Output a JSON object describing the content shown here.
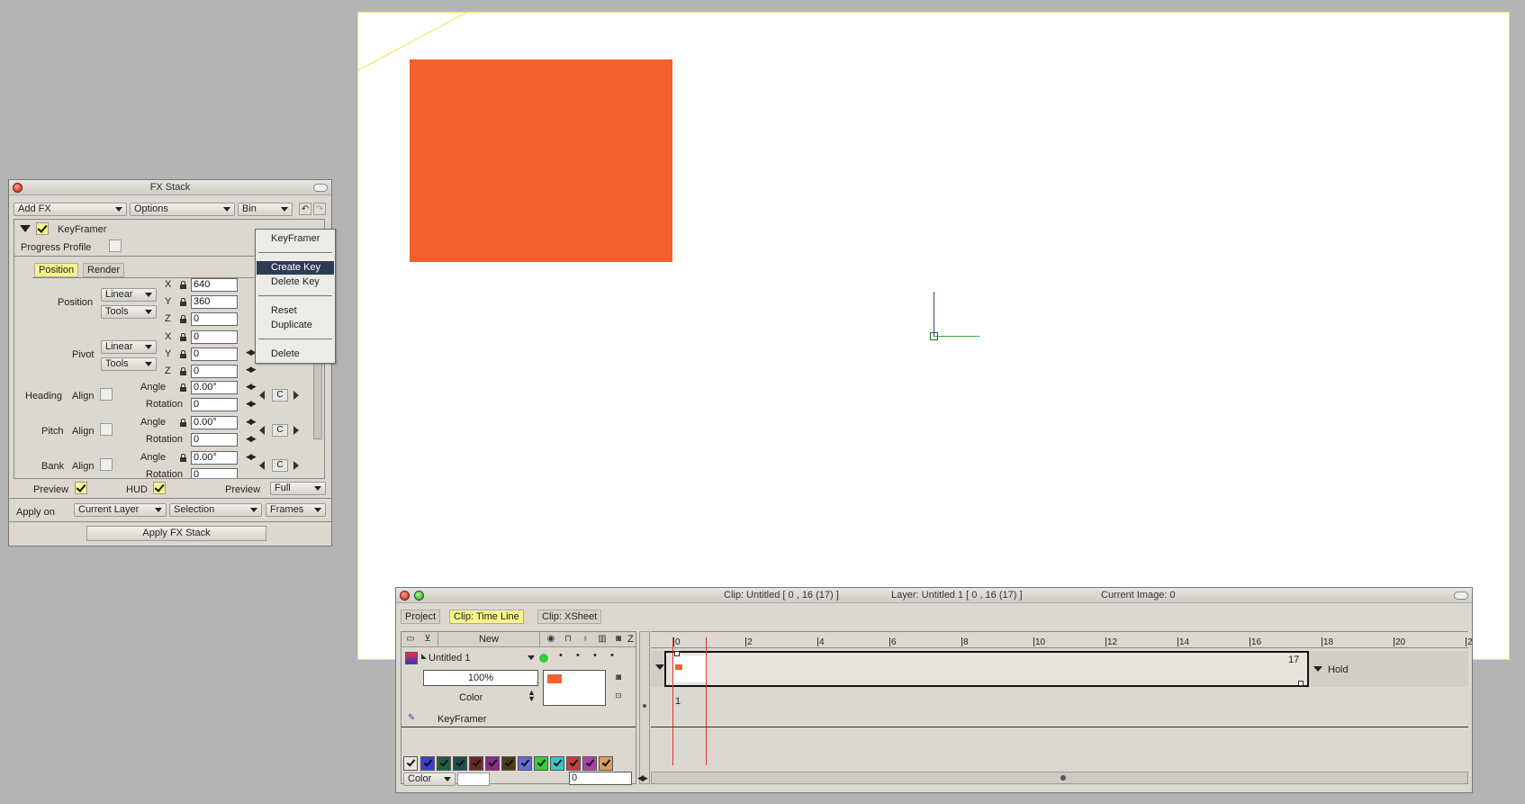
{
  "fx_stack": {
    "title": "FX Stack",
    "add_fx": "Add FX",
    "options": "Options",
    "bin": "Bin",
    "effect_name": "KeyFramer",
    "progress_profile": "Progress Profile",
    "tabs": [
      "Position",
      "Render"
    ],
    "position_label": "Position",
    "pivot_label": "Pivot",
    "linear": "Linear",
    "tools": "Tools",
    "axes": [
      "X",
      "Y",
      "Z"
    ],
    "position_values": [
      "640",
      "360",
      "0"
    ],
    "pivot_values": [
      "0",
      "0",
      "0"
    ],
    "heading_label": "Heading",
    "pitch_label": "Pitch",
    "bank_label": "Bank",
    "align": "Align",
    "angle": "Angle",
    "rotation": "Rotation",
    "angle_value": "0.00°",
    "rotation_value": "0",
    "c_label": "C",
    "preview_label": "Preview",
    "hud_label": "HUD",
    "preview_mode_label": "Preview",
    "preview_mode": "Full",
    "apply_on": "Apply on",
    "current_layer": "Current Layer",
    "selection": "Selection",
    "frames": "Frames",
    "apply_button": "Apply FX Stack"
  },
  "menu": {
    "items": [
      "KeyFramer",
      "Create Key",
      "Delete Key",
      "Reset",
      "Duplicate",
      "Delete"
    ],
    "highlighted": "Create Key"
  },
  "canvas": {
    "rect_color": "#f2622e"
  },
  "timeline": {
    "clip_info": "Clip: Untitled [ 0 , 16  (17) ]",
    "layer_info": "Layer: Untitled 1 [ 0 , 16  (17) ]",
    "current_image": "Current Image: 0",
    "tabs": [
      "Project",
      "Clip: Time Line",
      "Clip: XSheet"
    ],
    "new_label": "New",
    "z_label": "Z",
    "layer_name": "Untitled 1",
    "opacity": "100%",
    "color_mode": "Color",
    "fx_name": "KeyFramer",
    "ruler_labels": [
      "0",
      "2",
      "4",
      "6",
      "8",
      "10",
      "12",
      "14",
      "16",
      "18",
      "20",
      "2"
    ],
    "end_frame": "17",
    "start_frame": "1",
    "hold_label": "Hold",
    "bottom_color": "Color",
    "frame_input": "0",
    "swatch_colors": [
      "#3d3dd8",
      "#1f5f3c",
      "#1f4f4f",
      "#6a2a2a",
      "#8a2a8a",
      "#4a3a1a",
      "#6a6ad8",
      "#3acd3a",
      "#3ac6c6",
      "#c04040",
      "#b040b0",
      "#d8a060"
    ]
  }
}
